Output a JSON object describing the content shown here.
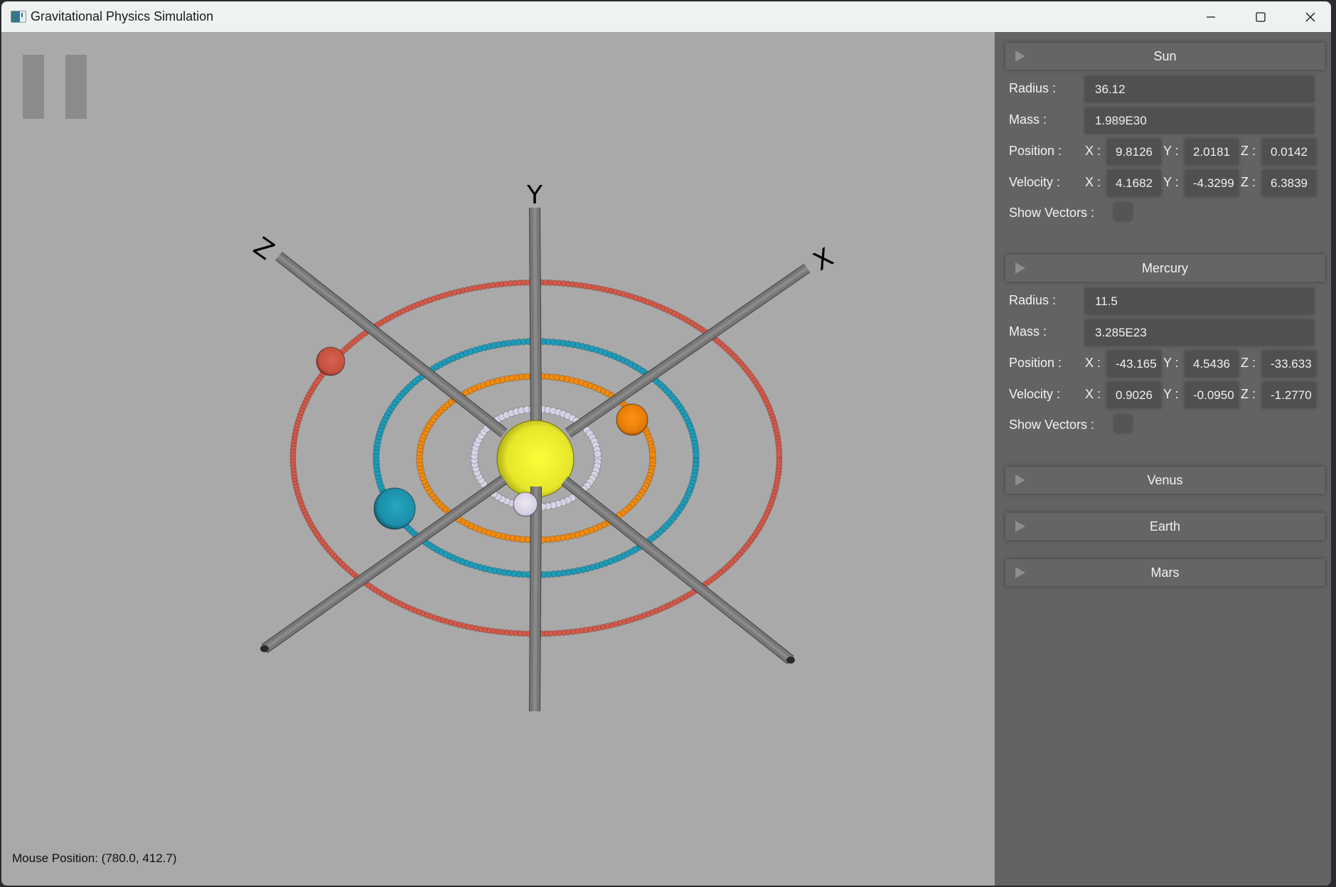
{
  "window": {
    "title": "Gravitational Physics Simulation",
    "controls": [
      "minimize",
      "maximize",
      "close"
    ]
  },
  "scene": {
    "paused": true,
    "status": "Mouse Position: (780.0, 412.7)",
    "axes": [
      {
        "name": "X",
        "label": "X"
      },
      {
        "name": "Y",
        "label": "Y"
      },
      {
        "name": "Z",
        "label": "Z"
      }
    ],
    "bodies": [
      {
        "name": "Sun",
        "color": "#f5f538"
      },
      {
        "name": "Mercury",
        "color": "#dcd6e8"
      },
      {
        "name": "Venus",
        "color": "#f08a10"
      },
      {
        "name": "Earth",
        "color": "#1f9bb8"
      },
      {
        "name": "Mars",
        "color": "#d35a4a"
      }
    ],
    "orbits": [
      {
        "body": "Mercury",
        "color": "#d8d2e6"
      },
      {
        "body": "Venus",
        "color": "#f08a10"
      },
      {
        "body": "Earth",
        "color": "#1f9bb8"
      },
      {
        "body": "Mars",
        "color": "#d35a4a"
      }
    ]
  },
  "panel": {
    "labels": {
      "radius": "Radius :",
      "mass": "Mass :",
      "position": "Position :",
      "velocity": "Velocity :",
      "show_vectors": "Show Vectors :",
      "x": "X :",
      "y": "Y :",
      "z": "Z :"
    },
    "sections": [
      {
        "name": "Sun",
        "expanded": true,
        "radius": "36.12",
        "mass": "1.989E30",
        "position": {
          "x": "9.8126",
          "y": "2.0181",
          "z": "0.0142"
        },
        "velocity": {
          "x": "4.1682",
          "y": "-4.3299",
          "z": "6.3839"
        },
        "show_vectors": false
      },
      {
        "name": "Mercury",
        "expanded": true,
        "radius": "11.5",
        "mass": "3.285E23",
        "position": {
          "x": "-43.165",
          "y": "4.5436",
          "z": "-33.633"
        },
        "velocity": {
          "x": "0.9026",
          "y": "-0.0950",
          "z": "-1.2770"
        },
        "show_vectors": false
      },
      {
        "name": "Venus",
        "expanded": false
      },
      {
        "name": "Earth",
        "expanded": false
      },
      {
        "name": "Mars",
        "expanded": false
      }
    ]
  }
}
